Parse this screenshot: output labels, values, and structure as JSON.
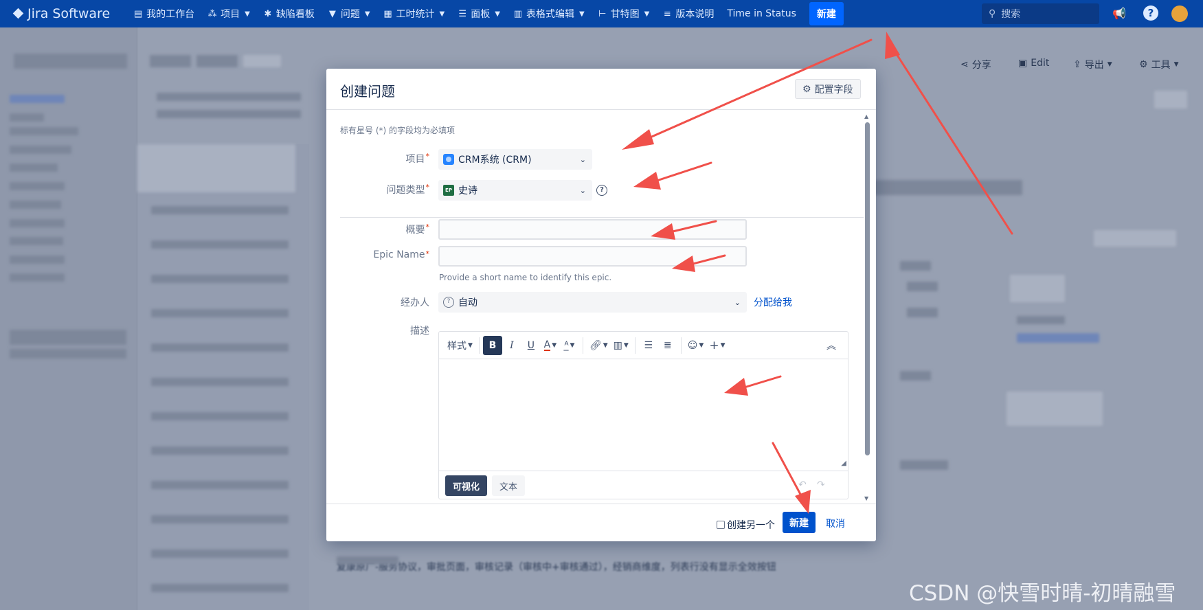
{
  "app": {
    "name": "Jira Software"
  },
  "nav": {
    "items": [
      {
        "label": "我的工作台",
        "icon": "dashboard-icon",
        "dropdown": false
      },
      {
        "label": "项目",
        "icon": "projects-icon",
        "dropdown": true
      },
      {
        "label": "缺陷看板",
        "icon": "bug-icon",
        "dropdown": false
      },
      {
        "label": "问题",
        "icon": "filter-icon",
        "dropdown": true
      },
      {
        "label": "工时统计",
        "icon": "calendar-icon",
        "dropdown": true
      },
      {
        "label": "面板",
        "icon": "board-icon",
        "dropdown": true
      },
      {
        "label": "表格式编辑",
        "icon": "table-icon",
        "dropdown": true
      },
      {
        "label": "甘特图",
        "icon": "gantt-icon",
        "dropdown": true
      },
      {
        "label": "版本说明",
        "icon": "release-notes-icon",
        "dropdown": false
      },
      {
        "label": "Time in Status",
        "icon": "",
        "dropdown": false
      }
    ],
    "create_label": "新建",
    "search_placeholder": "搜索"
  },
  "background": {
    "toolbar": {
      "share": "分享",
      "edit": "Edit",
      "export": "导出",
      "tools": "工具"
    },
    "description_snippet": "复康原厂-服务协议，审批页面，审核记录（审核中+审核通过），经销商维度，列表行没有显示全效按钮"
  },
  "modal": {
    "title": "创建问题",
    "config_fields": "配置字段",
    "required_note": "标有星号 (*) 的字段均为必填项",
    "fields": {
      "project": {
        "label": "项目",
        "value": "CRM系统 (CRM)"
      },
      "issue_type": {
        "label": "问题类型",
        "value": "史诗",
        "icon_text": "EP"
      },
      "summary": {
        "label": "概要",
        "value": ""
      },
      "epic_name": {
        "label": "Epic Name",
        "value": "",
        "hint": "Provide a short name to identify this epic."
      },
      "assignee": {
        "label": "经办人",
        "value": "自动",
        "assign_to_me": "分配给我"
      },
      "description": {
        "label": "描述",
        "value": ""
      }
    },
    "editor": {
      "style_label": "样式",
      "bold": "B",
      "italic": "I",
      "underline": "U",
      "text_color": "A",
      "visual_mode": "可视化",
      "text_mode": "文本"
    },
    "footer": {
      "create_another": "创建另一个",
      "submit": "新建",
      "cancel": "取消"
    }
  },
  "colors": {
    "nav_bg": "#0747a6",
    "primary": "#0052cc",
    "arrow": "#f0504a",
    "required": "#de350b"
  },
  "watermark": "CSDN @快雪时晴-初晴融雪"
}
